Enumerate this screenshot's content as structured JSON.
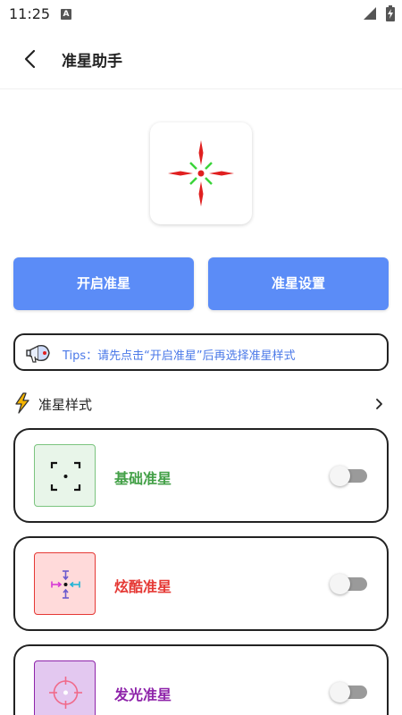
{
  "status_bar": {
    "time": "11:25",
    "notification_icon": "A",
    "signal_icon": "cell-signal-icon",
    "battery_icon": "battery-charging-icon"
  },
  "app_bar": {
    "back_icon": "chevron-left-icon",
    "title": "准星助手"
  },
  "preview": {
    "icon": "crosshair-preview-icon",
    "colors": {
      "arms": "#e02020",
      "diagonals": "#3ad43a",
      "center": "#e02020"
    }
  },
  "actions": {
    "start_label": "开启准星",
    "settings_label": "准星设置",
    "color": "#5b8cf7"
  },
  "tips": {
    "icon": "megaphone-icon",
    "text": "Tips：请先点击“开启准星”后再选择准星样式",
    "color": "#4b79e8"
  },
  "styles_section": {
    "icon": "lightning-bolt-icon",
    "title": "准星样式",
    "more_icon": "chevron-right-icon"
  },
  "styles": [
    {
      "name": "基础准星",
      "name_color": "#43a047",
      "thumb_bg": "#e8f5e9",
      "thumb_border": "#7bc47f",
      "icon": "bracket-crosshair-icon",
      "enabled": false
    },
    {
      "name": "炫酷准星",
      "name_color": "#e53935",
      "thumb_bg": "#ffdada",
      "thumb_border": "#e53935",
      "icon": "arrow-crosshair-icon",
      "enabled": false
    },
    {
      "name": "发光准星",
      "name_color": "#8e24aa",
      "thumb_bg": "#e3c8f0",
      "thumb_border": "#8e24aa",
      "icon": "scope-crosshair-icon",
      "enabled": false
    }
  ]
}
